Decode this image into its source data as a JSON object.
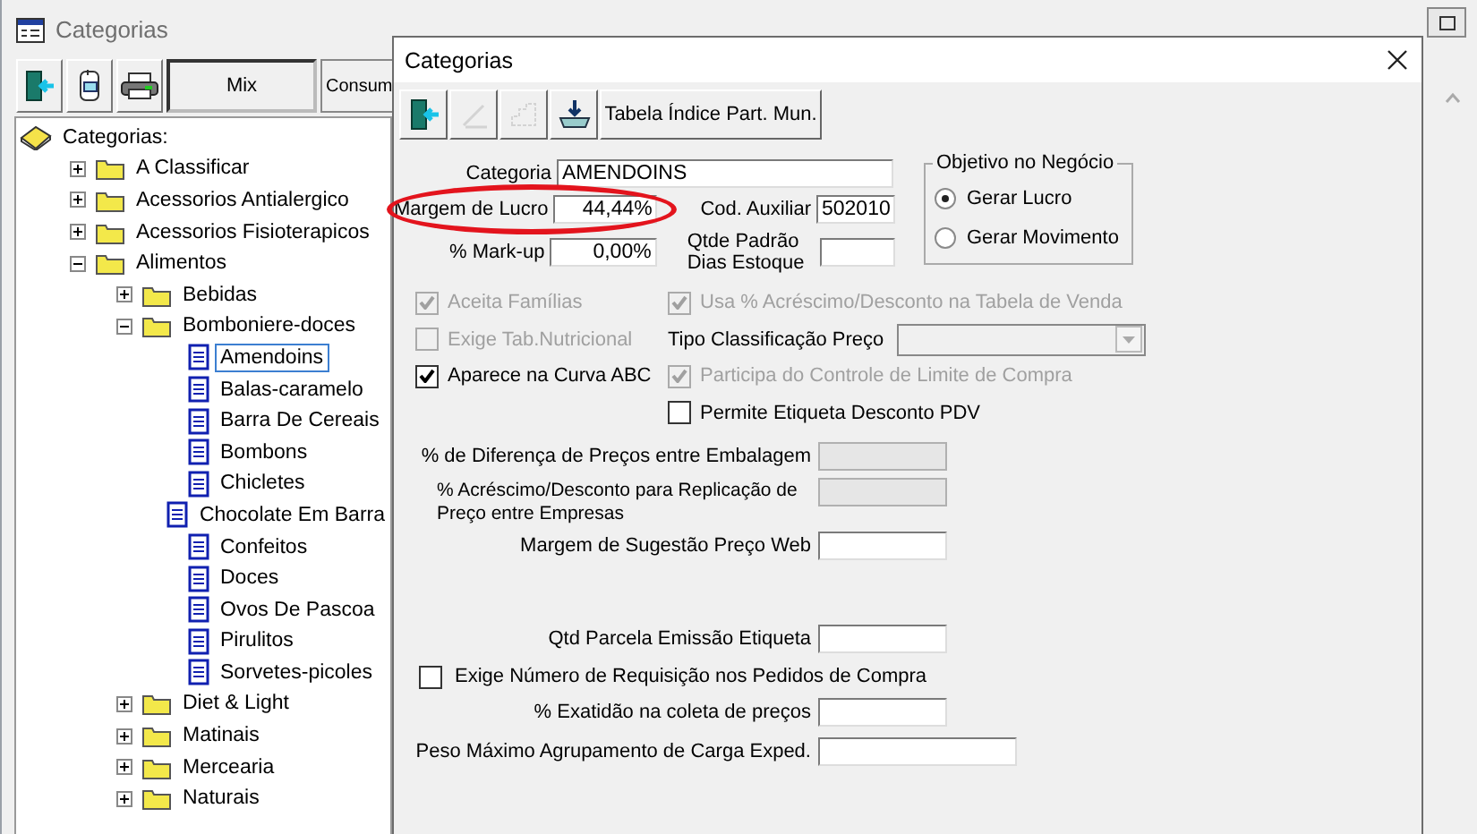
{
  "window": {
    "title": "Categorias"
  },
  "tabs": [
    {
      "label": "Mix",
      "selected": true
    },
    {
      "label": "Consum",
      "selected": false
    }
  ],
  "tree": {
    "root": "Categorias:",
    "items": [
      {
        "label": "A Classificar",
        "kind": "folder",
        "expanded": false,
        "selected": false
      },
      {
        "label": "Acessorios Antialergico",
        "kind": "folder",
        "expanded": false,
        "selected": false
      },
      {
        "label": "Acessorios Fisioterapicos",
        "kind": "folder",
        "expanded": false,
        "selected": false
      },
      {
        "label": "Alimentos",
        "kind": "folder",
        "expanded": true,
        "selected": false,
        "children": [
          {
            "label": "Bebidas",
            "kind": "folder",
            "expanded": false,
            "selected": false
          },
          {
            "label": "Bomboniere-doces",
            "kind": "folder",
            "expanded": true,
            "selected": false,
            "children": [
              {
                "label": "Amendoins",
                "kind": "leaf",
                "selected": true
              },
              {
                "label": "Balas-caramelo",
                "kind": "leaf",
                "selected": false
              },
              {
                "label": "Barra De Cereais",
                "kind": "leaf",
                "selected": false
              },
              {
                "label": "Bombons",
                "kind": "leaf",
                "selected": false
              },
              {
                "label": "Chicletes",
                "kind": "leaf",
                "selected": false
              },
              {
                "label": "Chocolate Em Barra",
                "kind": "leaf",
                "selected": false
              },
              {
                "label": "Confeitos",
                "kind": "leaf",
                "selected": false
              },
              {
                "label": "Doces",
                "kind": "leaf",
                "selected": false
              },
              {
                "label": "Ovos De Pascoa",
                "kind": "leaf",
                "selected": false
              },
              {
                "label": "Pirulitos",
                "kind": "leaf",
                "selected": false
              },
              {
                "label": "Sorvetes-picoles",
                "kind": "leaf",
                "selected": false
              }
            ]
          },
          {
            "label": "Diet & Light",
            "kind": "folder",
            "expanded": false,
            "selected": false
          },
          {
            "label": "Matinais",
            "kind": "folder",
            "expanded": false,
            "selected": false
          },
          {
            "label": "Mercearia",
            "kind": "folder",
            "expanded": false,
            "selected": false
          },
          {
            "label": "Naturais",
            "kind": "folder",
            "expanded": false,
            "selected": false
          }
        ]
      }
    ]
  },
  "dialog": {
    "title": "Categorias",
    "toolbar": [
      {
        "disabled": false
      },
      {
        "disabled": true
      },
      {
        "disabled": true
      },
      {
        "disabled": false
      }
    ],
    "table_button": "Tabela Índice Part. Mun.",
    "categoria": {
      "label": "Categoria",
      "value": "AMENDOINS"
    },
    "margem_lucro": {
      "label": "Margem de Lucro",
      "value": "44,44%",
      "highlighted": true
    },
    "cod_auxiliar": {
      "label": "Cod. Auxiliar",
      "value": "502010"
    },
    "markup": {
      "label": "% Mark-up",
      "value": "0,00%"
    },
    "qtde_padrao": {
      "label": "Qtde Padrão Dias Estoque"
    },
    "objetivo": {
      "title": "Objetivo no Negócio",
      "options": [
        {
          "label": "Gerar Lucro",
          "selected": true
        },
        {
          "label": "Gerar Movimento",
          "selected": false
        }
      ]
    },
    "flags_left": [
      {
        "label": "Aceita Famílias",
        "checked": true,
        "disabled": true
      },
      {
        "label": "Exige Tab.Nutricional",
        "checked": false,
        "disabled": true
      },
      {
        "label": "Aparece na Curva ABC",
        "checked": true,
        "disabled": false
      }
    ],
    "flags_right": [
      {
        "kind": "checkbox",
        "label": "Usa % Acréscimo/Desconto na Tabela de Venda",
        "checked": true,
        "disabled": true
      },
      {
        "kind": "combo",
        "label": "Tipo Classificação Preço",
        "disabled": true
      },
      {
        "kind": "checkbox",
        "label": "Participa do Controle de Limite de Compra",
        "checked": true,
        "disabled": true
      },
      {
        "kind": "checkbox",
        "label": "Permite Etiqueta Desconto PDV",
        "checked": false,
        "disabled": false
      }
    ],
    "lower": [
      {
        "kind": "field",
        "label": "% de Diferença de Preços entre Embalagem",
        "disabled": true
      },
      {
        "kind": "wrapped_field",
        "label": "% Acréscimo/Desconto para Replicação de Preço entre Empresas",
        "disabled": true
      },
      {
        "kind": "field",
        "label": "Margem de Sugestão Preço Web",
        "disabled": false
      },
      {
        "kind": "field",
        "label": "Qtd Parcela Emissão Etiqueta",
        "disabled": false
      },
      {
        "kind": "checkbox",
        "label": "Exige Número de Requisição nos Pedidos de Compra",
        "checked": false,
        "disabled": false
      },
      {
        "kind": "field",
        "label": "% Exatidão na coleta de preços",
        "disabled": false
      },
      {
        "kind": "field",
        "label": "Peso Máximo Agrupamento de Carga Exped.",
        "disabled": false
      }
    ]
  }
}
